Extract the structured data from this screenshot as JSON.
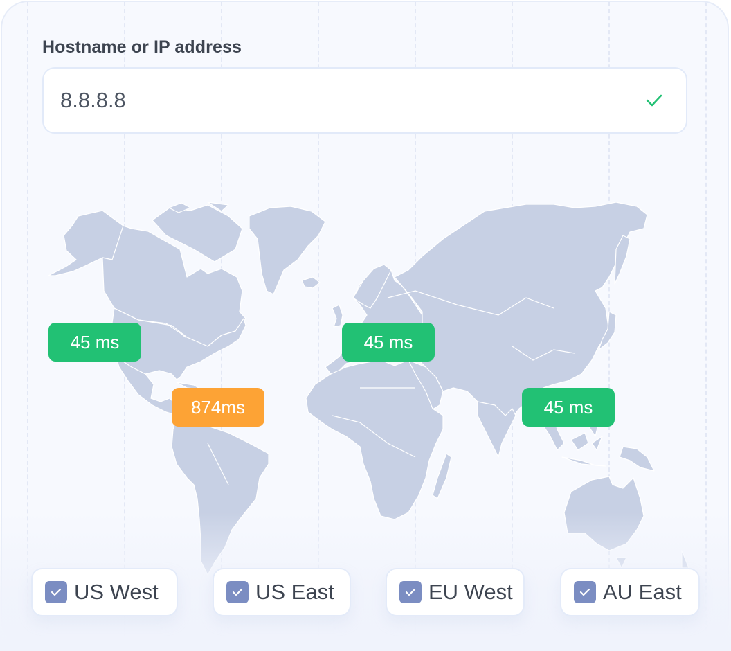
{
  "form": {
    "label": "Hostname or IP address",
    "input_value": "8.8.8.8",
    "input_placeholder": "",
    "validation_icon": "check-icon",
    "validation_color": "#22c174"
  },
  "latency_badges": [
    {
      "region": "US West",
      "text": "45 ms",
      "status": "ok",
      "color": "#22c174"
    },
    {
      "region": "US East",
      "text": "874ms",
      "status": "slow",
      "color": "#fda335"
    },
    {
      "region": "EU West",
      "text": "45 ms",
      "status": "ok",
      "color": "#22c174"
    },
    {
      "region": "AU East",
      "text": "45 ms",
      "status": "ok",
      "color": "#22c174"
    }
  ],
  "regions": [
    {
      "label": "US West",
      "checked": true
    },
    {
      "label": "US East",
      "checked": true
    },
    {
      "label": "EU West",
      "checked": true
    },
    {
      "label": "AU East",
      "checked": true
    }
  ],
  "colors": {
    "map_land": "#c7d0e4",
    "checkbox": "#7b8dc2",
    "card_bg": "#f7f9fe"
  }
}
